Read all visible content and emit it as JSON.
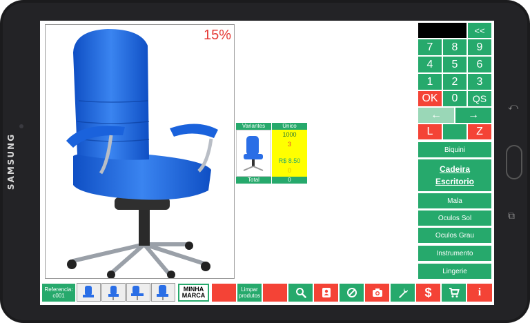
{
  "device": {
    "brand": "SAMSUNG"
  },
  "product": {
    "discount": "15%",
    "image_icon": "blue-office-chair"
  },
  "variants": {
    "header_variants": "Variantes",
    "header_unique": "Único",
    "code": "1000",
    "stock": "3",
    "price": "R$ 8.50",
    "extra": "0",
    "total_label": "Total",
    "total_value": "0"
  },
  "keypad": {
    "back": "<<",
    "rows": [
      [
        "7",
        "8",
        "9"
      ],
      [
        "4",
        "5",
        "6"
      ],
      [
        "1",
        "2",
        "3"
      ]
    ],
    "ok": "OK",
    "zero": "0",
    "qs": "QS",
    "left_arrow": "←",
    "right_arrow": "→",
    "l": "L",
    "z": "Z"
  },
  "categories": [
    "Biquini",
    "Cadeira Escritorio",
    "Mala",
    "Oculos Sol",
    "Oculos Grau",
    "Instrumento",
    "Lingerie"
  ],
  "bottom": {
    "reference_label": "Referencia:",
    "reference_value": "c001",
    "brand_button": "MINHA MARCA",
    "clear_products": "Limpar produtos",
    "icons": [
      "search-icon",
      "contact-icon",
      "cancel-icon",
      "camera-icon",
      "wrench-icon",
      "dollar-icon",
      "cart-icon",
      "info-icon"
    ]
  },
  "colors": {
    "green": "#26a96c",
    "red": "#f44336",
    "yellow": "#ffff00",
    "chair": "#1e5fd8"
  }
}
